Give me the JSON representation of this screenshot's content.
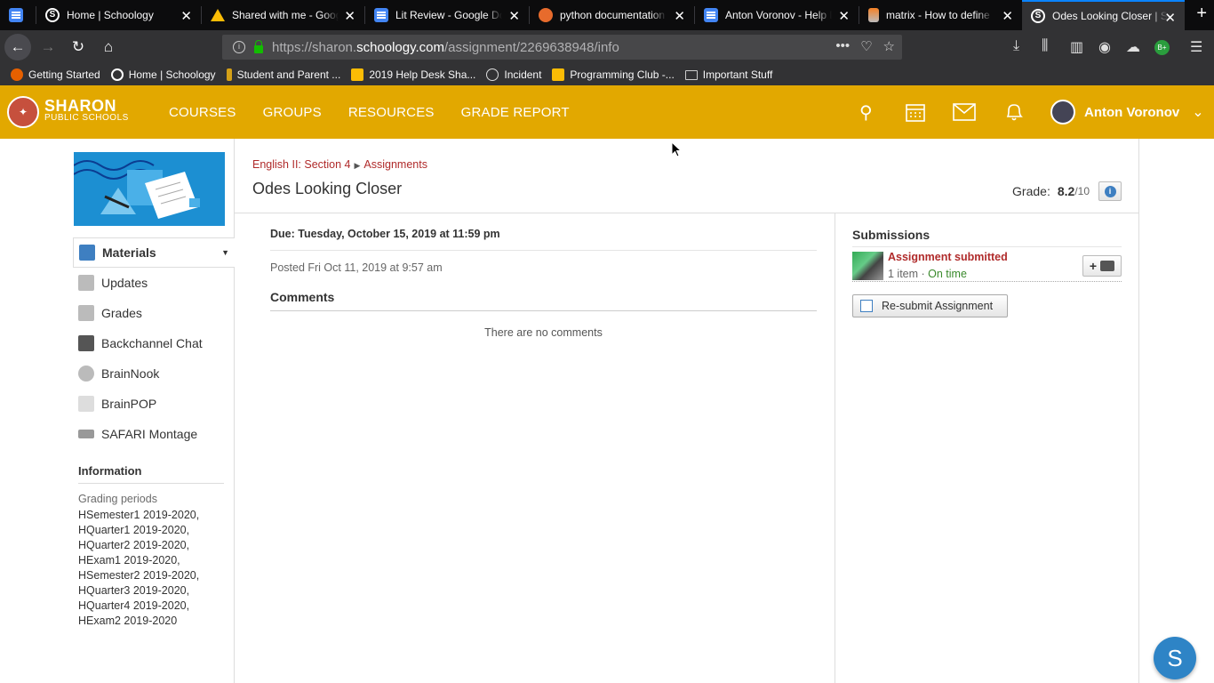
{
  "browser": {
    "tabs": [
      {
        "title": "",
        "icon": "google-docs-icon"
      },
      {
        "title": "Home | Schoology",
        "icon": "schoology-icon"
      },
      {
        "title": "Shared with me - Google Drive",
        "icon": "google-drive-icon"
      },
      {
        "title": "Lit Review - Google Docs",
        "icon": "google-docs-icon"
      },
      {
        "title": "python documentation",
        "icon": "duckduckgo-icon"
      },
      {
        "title": "Anton Voronov - Help Desk",
        "icon": "google-docs-icon"
      },
      {
        "title": "matrix - How to define",
        "icon": "stackoverflow-icon"
      },
      {
        "title": "Odes Looking Closer | Schoology",
        "icon": "schoology-icon"
      }
    ],
    "url_prefix": "https://sharon.",
    "url_domain": "schoology.com",
    "url_path": "/assignment/2269638948/info",
    "bookmarks": [
      {
        "label": "Getting Started",
        "icon": "firefox-icon"
      },
      {
        "label": "Home | Schoology",
        "icon": "schoology-icon"
      },
      {
        "label": "Student and Parent ...",
        "icon": "pearson-icon"
      },
      {
        "label": "2019 Help Desk Sha...",
        "icon": "google-drive-icon"
      },
      {
        "label": "Incident",
        "icon": "globe-icon"
      },
      {
        "label": "Programming Club -...",
        "icon": "google-drive-icon"
      },
      {
        "label": "Important Stuff",
        "icon": "folder-icon"
      }
    ],
    "extension_badge": "B+"
  },
  "header": {
    "logo_line1": "SHARON",
    "logo_line2": "PUBLIC SCHOOLS",
    "nav": [
      "COURSES",
      "GROUPS",
      "RESOURCES",
      "GRADE REPORT"
    ],
    "user_name": "Anton Voronov"
  },
  "sidebar": {
    "items": [
      {
        "label": "Materials"
      },
      {
        "label": "Updates"
      },
      {
        "label": "Grades"
      },
      {
        "label": "Backchannel Chat"
      },
      {
        "label": "BrainNook"
      },
      {
        "label": "BrainPOP"
      },
      {
        "label": "SAFARI Montage"
      }
    ],
    "info_heading": "Information",
    "grading_periods_label": "Grading periods",
    "grading_periods": [
      "HSemester1 2019-2020,",
      "HQuarter1 2019-2020,",
      "HQuarter2 2019-2020,",
      "HExam1 2019-2020,",
      "HSemester2 2019-2020,",
      "HQuarter3 2019-2020,",
      "HQuarter4 2019-2020,",
      "HExam2 2019-2020"
    ]
  },
  "main": {
    "breadcrumb_course": "English II: Section 4",
    "breadcrumb_section": "Assignments",
    "title": "Odes Looking Closer",
    "grade_label": "Grade:",
    "grade_value": "8.2",
    "grade_max": "/10",
    "due": "Due: Tuesday, October 15, 2019 at 11:59 pm",
    "posted": "Posted Fri Oct 11, 2019 at 9:57 am",
    "comments_heading": "Comments",
    "no_comments": "There are no comments"
  },
  "submissions": {
    "heading": "Submissions",
    "status": "Assignment submitted",
    "items": "1 item",
    "separator": " · ",
    "timeliness": "On time",
    "resubmit_label": "Re-submit Assignment"
  },
  "colors": {
    "header_bg": "#e2a800",
    "link_red": "#b02b2b",
    "on_time_green": "#3a8a2c",
    "chat_blue": "#2e84c6"
  }
}
